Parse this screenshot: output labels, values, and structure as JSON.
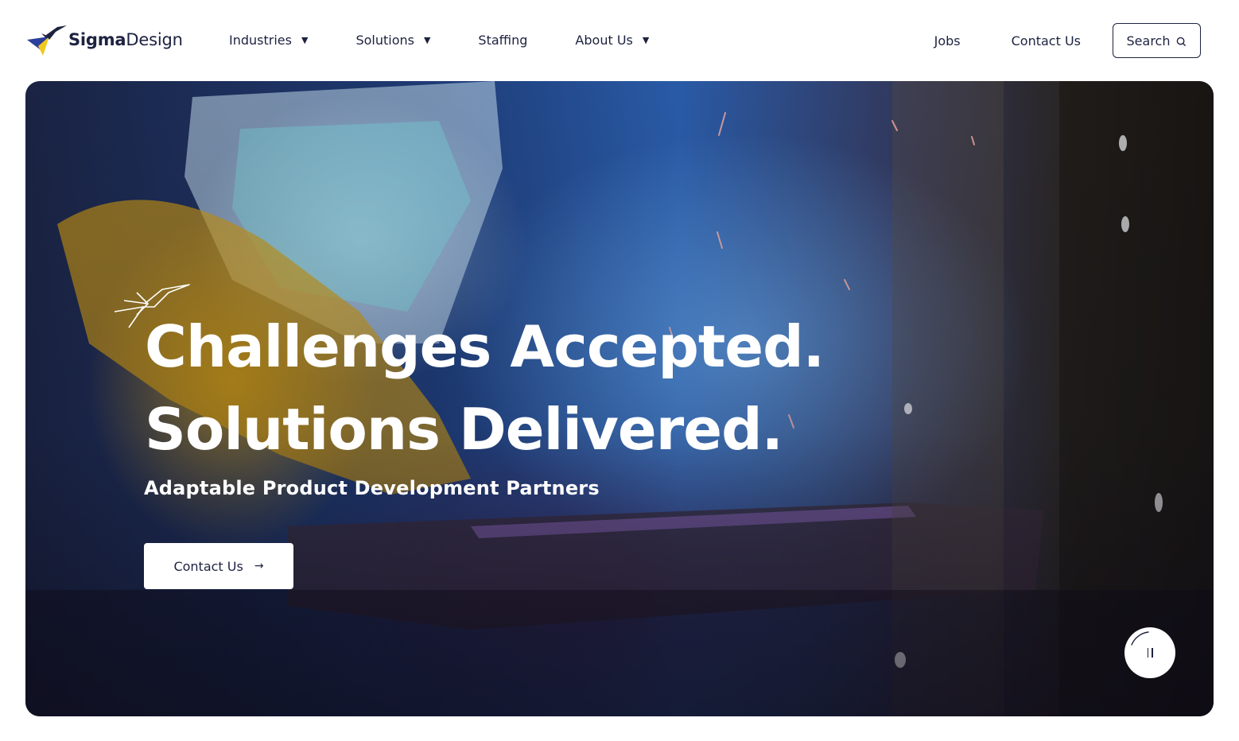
{
  "brand": {
    "name_bold": "Sigma",
    "name_light": "Design",
    "colors": {
      "primary": "#1d2240",
      "blue": "#2c3f9c",
      "yellow": "#f2c81b"
    }
  },
  "nav": {
    "items": [
      {
        "label": "Industries",
        "has_dropdown": true
      },
      {
        "label": "Solutions",
        "has_dropdown": true
      },
      {
        "label": "Staffing",
        "has_dropdown": false
      },
      {
        "label": "About Us",
        "has_dropdown": true
      }
    ],
    "caret": "▼",
    "jobs_label": "Jobs",
    "contact_label": "Contact Us",
    "search_label": "Search",
    "search_icon": "search-icon"
  },
  "hero": {
    "headline_line1": "Challenges Accepted.",
    "headline_line2": "Solutions Delivered.",
    "subheadline": "Adaptable Product Development Partners",
    "cta_label": "Contact Us",
    "cta_icon": "arrow-right-icon",
    "cta_arrow": "→",
    "pause_icon": "pause-icon"
  }
}
